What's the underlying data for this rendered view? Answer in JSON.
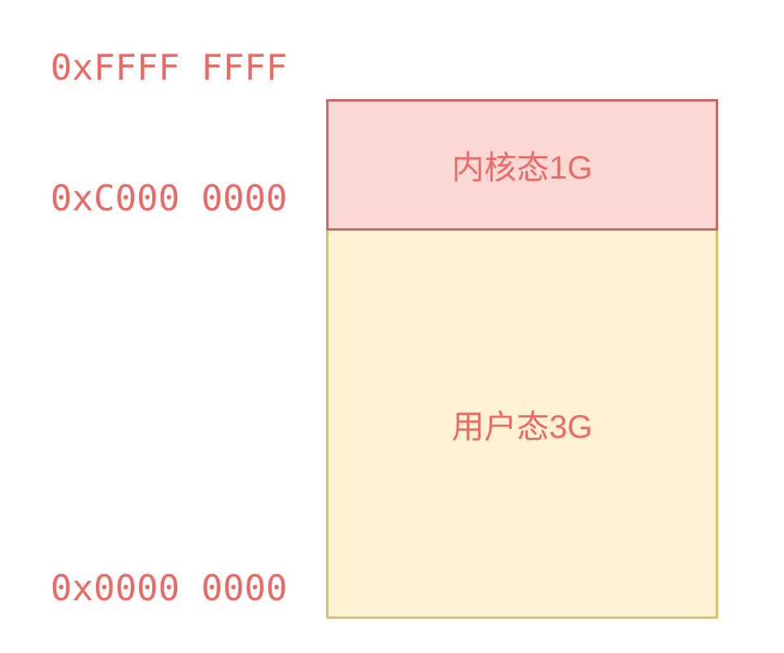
{
  "addresses": {
    "top": "0xFFFF FFFF",
    "boundary": "0xC000 0000",
    "bottom": "0x0000 0000"
  },
  "regions": {
    "kernel": {
      "label": "内核态1G",
      "fill_color": "#FAD9D5",
      "border_color": "#C96A66"
    },
    "user": {
      "label": "用户态3G",
      "fill_color": "#FFF2D4",
      "border_color": "#DCC06A"
    }
  },
  "colors": {
    "text": "#EA6B66"
  }
}
